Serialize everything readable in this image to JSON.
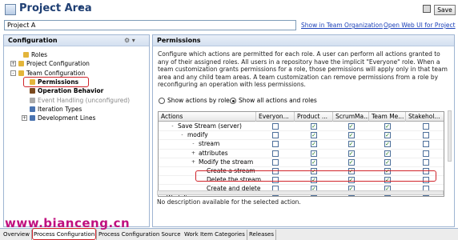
{
  "header": {
    "title": "Project Area",
    "menu_glyph": "▾",
    "save_label": "Save",
    "project_name": "Project A",
    "link_org": "Show in Team Organization",
    "link_webui": "Open Web UI for Project"
  },
  "left_panel": {
    "title": "Configuration",
    "tools_glyph": "⚙ ▾",
    "tree": [
      {
        "label": "Roles",
        "expander": "",
        "icon_color": "#e3b53b"
      },
      {
        "label": "Project Configuration",
        "expander": "+",
        "icon_color": "#e3b53b"
      },
      {
        "label": "Team Configuration",
        "expander": "-",
        "icon_color": "#e3b53b"
      },
      {
        "label": "Permissions",
        "expander": "",
        "icon_color": "#e3b53b"
      },
      {
        "label": "Operation Behavior",
        "expander": "",
        "icon_color": "#7b4a1e"
      },
      {
        "label": "Event Handling (unconfigured)",
        "expander": "",
        "icon_color": "#aaaaaa"
      },
      {
        "label": "Iteration Types",
        "expander": "",
        "icon_color": "#4a73b0"
      },
      {
        "label": "Development Lines",
        "expander": "+",
        "icon_color": "#4a73b0"
      }
    ]
  },
  "right_panel": {
    "title": "Permissions",
    "description": "Configure which actions are permitted for each role. A user can perform all actions granted to any of their assigned roles. All users in a repository have the implicit \"Everyone\" role. When a team customization grants permissions for a role, those permissions will apply only in that team area and any child team areas. A team customization can remove permissions from a role by reconfiguring an operation with less permissions.",
    "radio_by_role": "Show actions by role",
    "radio_all": "Show all actions and roles",
    "columns": [
      "Actions",
      "Everyon...",
      "Product ...",
      "ScrumMa...",
      "Team Me...",
      "Stakehol..."
    ],
    "rows": [
      {
        "label": "Save Stream (server)",
        "expander": "-",
        "checks": [
          false,
          true,
          true,
          true,
          false
        ]
      },
      {
        "label": "modify",
        "expander": "-",
        "checks": [
          false,
          true,
          true,
          true,
          false
        ]
      },
      {
        "label": "stream",
        "expander": "-",
        "checks": [
          false,
          true,
          true,
          true,
          false
        ]
      },
      {
        "label": "attributes",
        "expander": "+",
        "checks": [
          false,
          true,
          true,
          true,
          false
        ]
      },
      {
        "label": "Modify the stream",
        "expander": "+",
        "checks": [
          false,
          true,
          true,
          true,
          false
        ]
      },
      {
        "label": "Create a stream",
        "expander": "",
        "checks": [
          false,
          true,
          true,
          true,
          false
        ]
      },
      {
        "label": "Delete the stream",
        "expander": "",
        "checks": [
          false,
          true,
          true,
          true,
          false
        ]
      },
      {
        "label": "Create and delete",
        "expander": "",
        "checks": [
          false,
          true,
          true,
          true,
          false
        ]
      },
      {
        "label": "Work Items",
        "expander": "-",
        "checks": [
          false,
          true,
          true,
          true,
          false
        ]
      }
    ],
    "status": "No description available for the selected action."
  },
  "bottom_tabs": [
    "Overview",
    "Process Configuration",
    "Process Configuration Source",
    "Work Item Categories",
    "Releases"
  ],
  "watermark": "www.bianceng.cn",
  "colors": {
    "accent_red": "#d0232a",
    "link": "#1a3fb8",
    "check_green": "#1b7a1b"
  }
}
